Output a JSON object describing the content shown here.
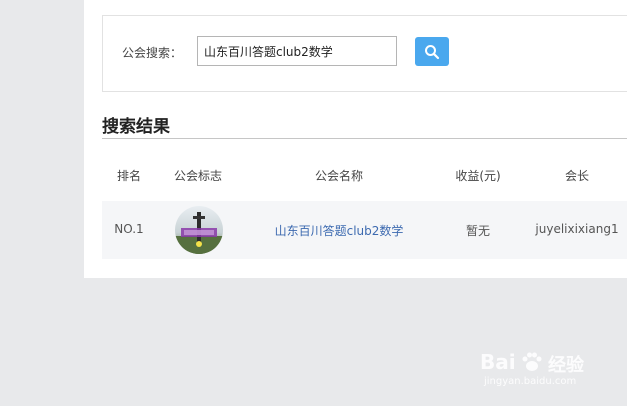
{
  "search": {
    "label": "公会搜索：",
    "value": "山东百川答题club2数学",
    "button_icon": "search-icon"
  },
  "results": {
    "title": "搜索结果",
    "columns": [
      "排名",
      "公会标志",
      "公会名称",
      "收益(元)",
      "会长"
    ],
    "rows": [
      {
        "rank": "NO.1",
        "logo_icon": "guild-logo-photo",
        "name": "山东百川答题club2数学",
        "income": "暂无",
        "leader": "juyelixixiang1"
      }
    ]
  },
  "watermark": {
    "brand": "Bai",
    "brand_suffix": "经验",
    "url": "jingyan.baidu.com"
  },
  "colors": {
    "page_bg": "#e8e9eb",
    "accent": "#4aa8ee",
    "link": "#3d6ab0"
  }
}
